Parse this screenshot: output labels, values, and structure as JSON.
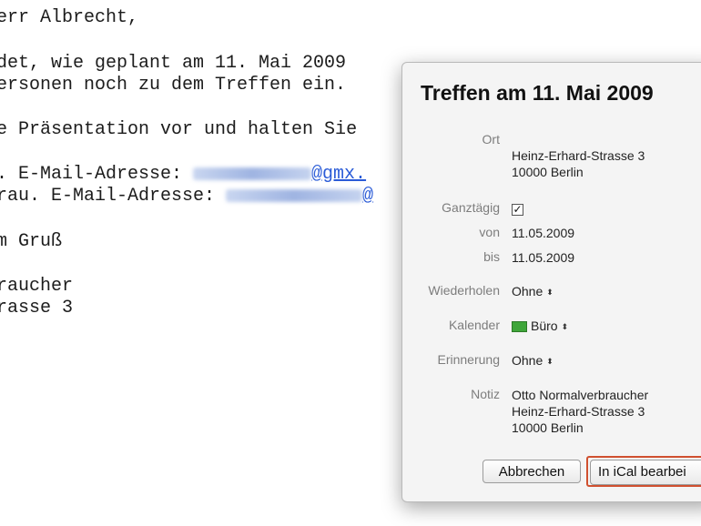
{
  "email": {
    "greeting": "err Albrecht,",
    "line1": "det, wie geplant am 11. Mai 2009",
    "line2": "ersonen noch zu dem Treffen ein.",
    "line3": "e Präsentation vor und halten Sie",
    "email1_label": ". E-Mail-Adresse: ",
    "email1_domain": "@gmx.",
    "email2_label": "rau. E-Mail-Adresse: ",
    "email2_domain": "@",
    "closing": "m Gruß",
    "name": "raucher",
    "street": "rasse 3"
  },
  "event": {
    "title": "Treffen am 11. Mai 2009",
    "fields": {
      "location_label": "Ort",
      "location_value": "Heinz-Erhard-Strasse 3\n10000 Berlin",
      "allday_label": "Ganztägig",
      "allday_checked": "☑",
      "from_label": "von",
      "from_value": "11.05.2009",
      "to_label": "bis",
      "to_value": "11.05.2009",
      "repeat_label": "Wiederholen",
      "repeat_value": "Ohne",
      "calendar_label": "Kalender",
      "calendar_value": "Büro",
      "calendar_color": "#3fa63a",
      "alert_label": "Erinnerung",
      "alert_value": "Ohne",
      "note_label": "Notiz",
      "note_value": "Otto Normalverbraucher\nHeinz-Erhard-Strasse 3\n10000 Berlin"
    },
    "buttons": {
      "cancel": "Abbrechen",
      "edit_in_ical": "In iCal bearbei"
    },
    "icons": {
      "popup_arrows": "⬍"
    }
  }
}
